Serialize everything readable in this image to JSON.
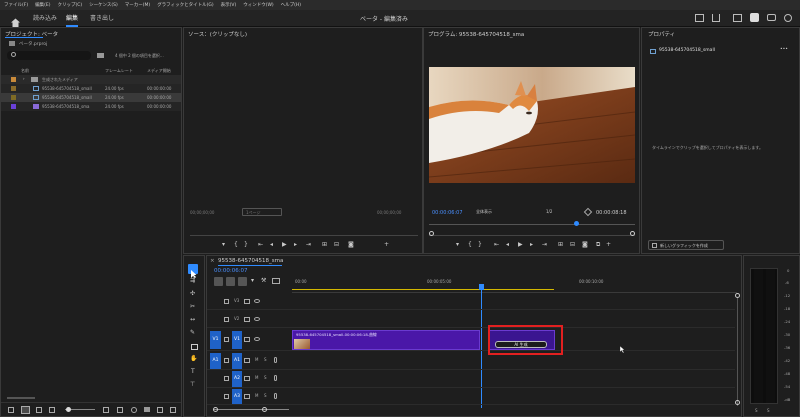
{
  "menu": [
    "ファイル(F)",
    "編集(E)",
    "クリップ(C)",
    "シーケンス(S)",
    "マーカー(M)",
    "グラフィックとタイトル(G)",
    "表示(V)",
    "ウィンドウ(W)",
    "ヘルプ(H)"
  ],
  "workspace": {
    "tabs": [
      "読み込み",
      "編集",
      "書き出し"
    ],
    "title": "ベータ - 編集済み"
  },
  "project": {
    "title": "プロジェクト: ベータ",
    "file": "ベータ.prproj",
    "selection_info": "4 個中 2 個の項目を選択...",
    "col_name": "名前",
    "col_framerate": "フレームレート",
    "col_media": "メディア開始",
    "rows": [
      {
        "name": "生成されたメディア",
        "fps": "",
        "start": ""
      },
      {
        "name": "95538-645704518_small",
        "fps": "24.00 fps",
        "start": "00:00:00:00"
      },
      {
        "name": "95538-645704518_small",
        "fps": "24.00 fps",
        "start": "00:00:00:00"
      },
      {
        "name": "95538-645704518_sma",
        "fps": "24.00 fps",
        "start": "00:00:00:00"
      }
    ],
    "row_colors": [
      "#c98a3a",
      "#8a6b2a",
      "#7f6b25",
      "#6a40d8"
    ]
  },
  "source": {
    "title": "ソース：(クリップなし)",
    "tc_left": "00;00;00;00",
    "tc_right": "00;00;00;00",
    "page": "1ページ"
  },
  "program": {
    "title": "プログラム: 95538-645704518_sma",
    "timecode": "00:00:06:07",
    "zoom": "全体表示",
    "quality": "1/2",
    "duration": "00:00:08:18"
  },
  "properties": {
    "title": "プロパティ",
    "clip": "95538-645704518_small",
    "message": "タイムラインでクリップを選択してプロパティを表示します。",
    "new_graphic": "新しいグラフィックを作成"
  },
  "timeline": {
    "sequence": "95538-645704518_sma",
    "timecode": "00:00:06:07",
    "ruler": [
      "00:00",
      "00:00:05:00",
      "00:00:10:00"
    ],
    "clip_label": "95538-645704518_small-00:00:06:18-曲線",
    "ai_button": "AI 生成",
    "tracks_v": [
      "V3",
      "V2",
      "V1"
    ],
    "tracks_a": [
      "A1",
      "A2",
      "A3"
    ],
    "src_v": "V1",
    "src_a": "A1"
  },
  "meter": {
    "scale": [
      "0",
      "-6",
      "-12",
      "-18",
      "-24",
      "-30",
      "-36",
      "-42",
      "-48",
      "-54",
      "-dB"
    ],
    "bottom": [
      "S",
      "S"
    ]
  }
}
